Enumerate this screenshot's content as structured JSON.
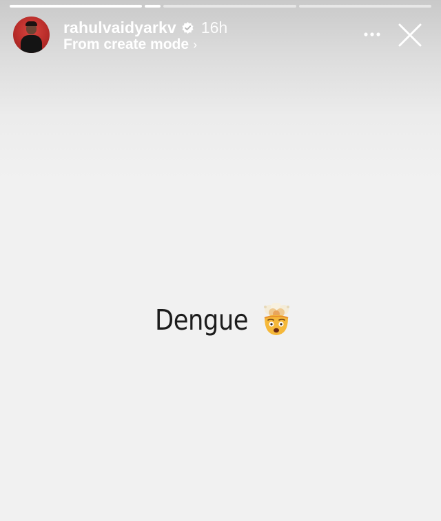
{
  "progress": {
    "segments": [
      {
        "filled": 1.0,
        "short": false
      },
      {
        "filled": 1.0,
        "short": true
      },
      {
        "filled": 0.0,
        "short": false
      },
      {
        "filled": 0.0,
        "short": false
      }
    ]
  },
  "header": {
    "username": "rahulvaidyarkv",
    "verified_icon": "verified-badge-icon",
    "time": "16h",
    "subline": "From create mode",
    "subline_chevron": "›",
    "more_icon": "more-horizontal-icon",
    "close_icon": "close-icon"
  },
  "content": {
    "caption": "Dengue",
    "emoji": "exploding-head-emoji"
  },
  "colors": {
    "background": "#f1f1f1",
    "header_text": "#ffffff",
    "caption_text": "#1c1c1c"
  }
}
